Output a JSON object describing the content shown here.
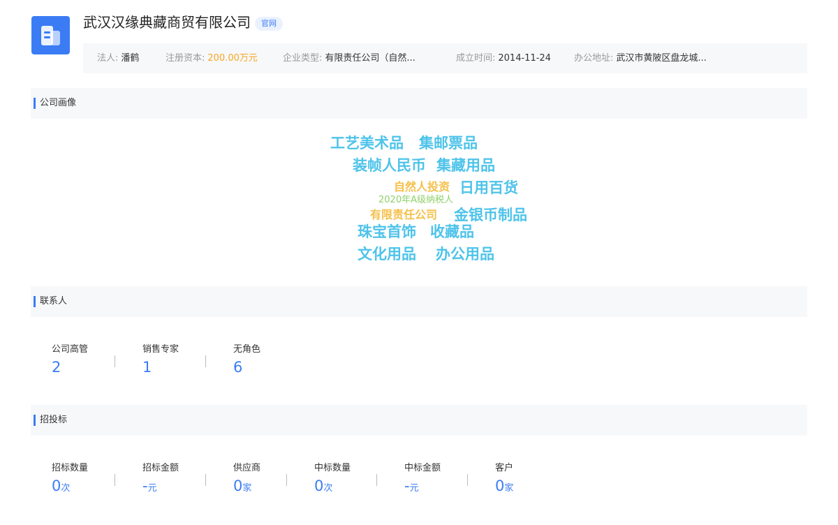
{
  "company": {
    "name": "武汉汉缘典藏商贸有限公司",
    "official_tag": "官网",
    "info": [
      {
        "key": "法人:",
        "value": "潘鹤"
      },
      {
        "key": "注册资本:",
        "value": "200.00万元"
      },
      {
        "key": "企业类型:",
        "value": "有限责任公司（自然..."
      },
      {
        "key": "成立时间:",
        "value": "2014-11-24"
      },
      {
        "key": "办公地址:",
        "value": "武汉市黄陂区盘龙城..."
      }
    ]
  },
  "colors": {
    "accent": "#3b7cf5",
    "orange": "#f5a623",
    "cloud_blue": "#4ec3ea",
    "cloud_orange": "#f5c04a",
    "cloud_green": "#8fd16a"
  },
  "portrait": {
    "title": "公司画像",
    "tags": [
      {
        "text": "工艺美术品",
        "color": "#4ec3ea"
      },
      {
        "text": "集邮票品",
        "color": "#4ec3ea"
      },
      {
        "text": "装帧人民币",
        "color": "#4ec3ea"
      },
      {
        "text": "集藏用品",
        "color": "#4ec3ea"
      },
      {
        "text": "自然人投资",
        "color": "#f5c04a"
      },
      {
        "text": "日用百货",
        "color": "#4ec3ea"
      },
      {
        "text": "2020年A级纳税人",
        "color": "#8fd16a"
      },
      {
        "text": "有限责任公司",
        "color": "#f5c04a"
      },
      {
        "text": "金银币制品",
        "color": "#4ec3ea"
      },
      {
        "text": "珠宝首饰",
        "color": "#4ec3ea"
      },
      {
        "text": "收藏品",
        "color": "#4ec3ea"
      },
      {
        "text": "文化用品",
        "color": "#4ec3ea"
      },
      {
        "text": "办公用品",
        "color": "#4ec3ea"
      }
    ]
  },
  "contacts": {
    "title": "联系人",
    "stats": [
      {
        "label": "公司高管",
        "value": "2",
        "unit": ""
      },
      {
        "label": "销售专家",
        "value": "1",
        "unit": ""
      },
      {
        "label": "无角色",
        "value": "6",
        "unit": ""
      }
    ]
  },
  "bidding": {
    "title": "招投标",
    "stats": [
      {
        "label": "招标数量",
        "value": "0",
        "unit": "次"
      },
      {
        "label": "招标金额",
        "value": "-",
        "unit": "元"
      },
      {
        "label": "供应商",
        "value": "0",
        "unit": "家"
      },
      {
        "label": "中标数量",
        "value": "0",
        "unit": "次"
      },
      {
        "label": "中标金额",
        "value": "-",
        "unit": "元"
      },
      {
        "label": "客户",
        "value": "0",
        "unit": "家"
      }
    ]
  }
}
